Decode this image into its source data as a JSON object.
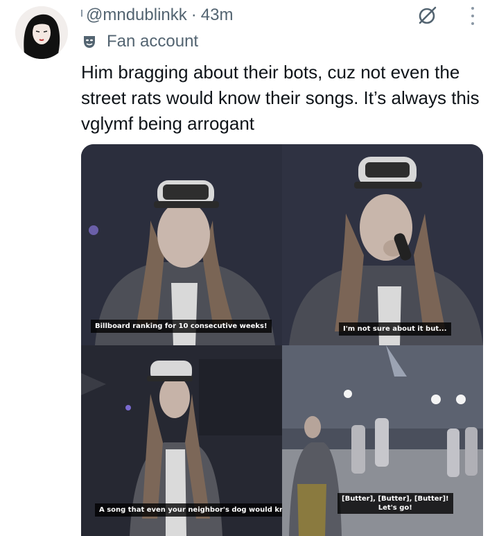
{
  "tweet": {
    "handle": "@mndublinkk",
    "separator": "·",
    "time": "43m",
    "label": "Fan account",
    "text": "Him bragging about their bots, cuz not even the street rats would know their songs. It’s always this vglymf being arrogant"
  },
  "icons": {
    "avatar": "avatar",
    "label": "theater-mask-icon",
    "grok": "slash-circle-icon",
    "more": "more-vertical-icon"
  },
  "media": {
    "captions": [
      "Billboard ranking for 10 consecutive weeks!",
      "I'm not sure about it but...",
      "A song that even your neighbor's dog would know!",
      "[Butter], [Butter], [Butter]!",
      "Let's go!"
    ]
  }
}
